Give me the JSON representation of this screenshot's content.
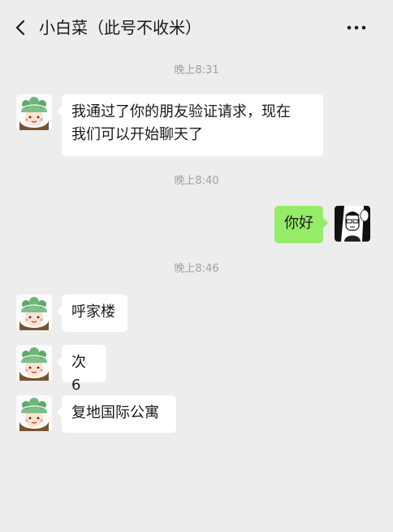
{
  "header": {
    "title": "小白菜（此号不收米）",
    "back_icon": "chevron-left-icon",
    "more_icon": "more-dots-icon"
  },
  "messages": [
    {
      "type": "time",
      "text": "晚上8:31"
    },
    {
      "type": "message",
      "side": "left",
      "text_line1": "我通过了你的朋友验证请求，现在",
      "text_line2": "我们可以开始聊天了"
    },
    {
      "type": "time",
      "text": "晚上8:40"
    },
    {
      "type": "message",
      "side": "right",
      "text": "你好"
    },
    {
      "type": "time",
      "text": "晚上8:46"
    },
    {
      "type": "message",
      "side": "left",
      "text": "呼家楼"
    },
    {
      "type": "message",
      "side": "left",
      "text": "次 6"
    },
    {
      "type": "message",
      "side": "left",
      "text": "复地国际公寓"
    }
  ],
  "colors": {
    "background": "#ededed",
    "bubble_left": "#ffffff",
    "bubble_right": "#95ec69",
    "timestamp": "#a0a0a0"
  }
}
